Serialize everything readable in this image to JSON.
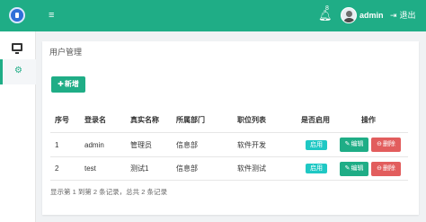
{
  "header": {
    "menu_toggle_icon": "menu-toggle-icon",
    "notification_count": "8",
    "username": "admin",
    "logout_label": "退出",
    "brand_color": "#1fad86"
  },
  "sidebar": {
    "items": [
      {
        "icon": "monitor-icon",
        "active": false
      },
      {
        "icon": "gear-icon",
        "active": true
      }
    ]
  },
  "panel": {
    "title": "用户管理",
    "add_button_label": "新增"
  },
  "table": {
    "columns": [
      "序号",
      "登录名",
      "真实名称",
      "所属部门",
      "职位列表",
      "是否启用",
      "操作"
    ],
    "rows": [
      {
        "id": "1",
        "login": "admin",
        "real_name": "管理员",
        "dept": "信息部",
        "role": "软件开发",
        "enabled": "启用",
        "edit": "编辑",
        "delete": "删除"
      },
      {
        "id": "2",
        "login": "test",
        "real_name": "测试1",
        "dept": "信息部",
        "role": "软件测试",
        "enabled": "启用",
        "edit": "编辑",
        "delete": "删除"
      }
    ]
  },
  "pagination": {
    "summary": "显示第 1 到第 2 条记录，总共 2 条记录"
  },
  "colors": {
    "primary": "#1fad86",
    "enabled_tag": "#1fc8c4",
    "danger": "#e25d5d"
  }
}
